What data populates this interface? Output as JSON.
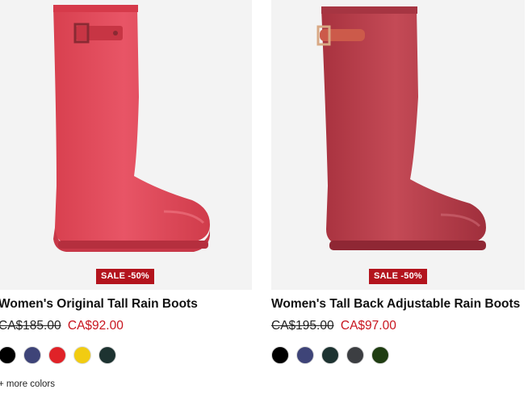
{
  "products": [
    {
      "name": "Women's Original Tall Rain Boots",
      "badge": "SALE -50%",
      "original_price": "CA$185.00",
      "sale_price": "CA$92.00",
      "colors": [
        "#000000",
        "#3e4478",
        "#e02228",
        "#f1cc12",
        "#1d3331"
      ],
      "more_colors": "+ more colors",
      "boot_color": "#e24b5c",
      "boot_shade": "#c73848"
    },
    {
      "name": "Women's Tall Back Adjustable Rain Boots",
      "badge": "SALE -50%",
      "original_price": "CA$195.00",
      "sale_price": "CA$97.00",
      "colors": [
        "#000000",
        "#3e4478",
        "#1d3331",
        "#3c3e42",
        "#1f3d12"
      ],
      "boot_color": "#ba3f4b",
      "boot_shade": "#9b2e3a"
    }
  ]
}
